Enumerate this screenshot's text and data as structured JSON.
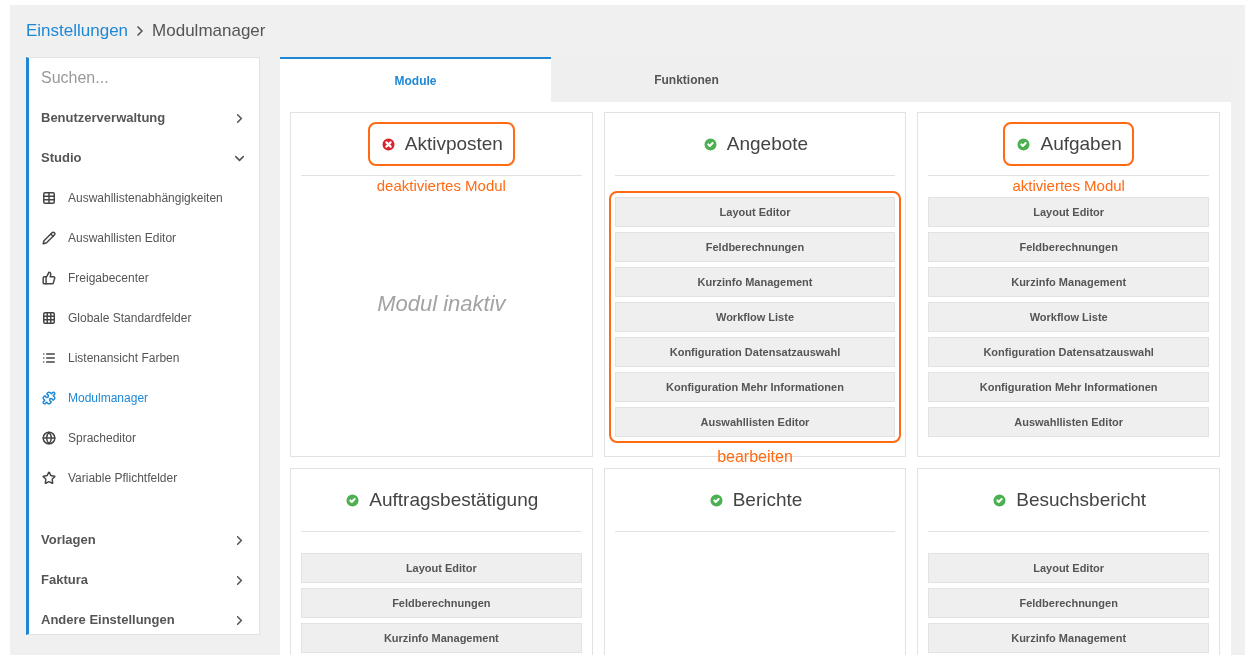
{
  "breadcrumb": {
    "parent": "Einstellungen",
    "current": "Modulmanager"
  },
  "sidebar": {
    "search_placeholder": "Suchen...",
    "sections": [
      {
        "label": "Benutzerverwaltung",
        "expanded": false
      },
      {
        "label": "Studio",
        "expanded": true,
        "children": [
          {
            "label": "Auswahllistenabhängigkeiten",
            "selected": false
          },
          {
            "label": "Auswahllisten Editor",
            "selected": false
          },
          {
            "label": "Freigabecenter",
            "selected": false
          },
          {
            "label": "Globale Standardfelder",
            "selected": false
          },
          {
            "label": "Listenansicht Farben",
            "selected": false
          },
          {
            "label": "Modulmanager",
            "selected": true
          },
          {
            "label": "Spracheditor",
            "selected": false
          },
          {
            "label": "Variable Pflichtfelder",
            "selected": false
          }
        ]
      },
      {
        "label": "Vorlagen",
        "expanded": false
      },
      {
        "label": "Faktura",
        "expanded": false
      },
      {
        "label": "Andere Einstellungen",
        "expanded": false
      }
    ]
  },
  "tabs": [
    {
      "label": "Module",
      "selected": true
    },
    {
      "label": "Funktionen",
      "selected": false
    }
  ],
  "modules": [
    {
      "name": "Aktivposten",
      "active": false,
      "title_highlighted": true,
      "annotation": "deaktiviertes Modul",
      "inactive_text": "Modul inaktiv"
    },
    {
      "name": "Angebote",
      "active": true,
      "buttons_highlighted": true,
      "buttons_annotation": "bearbeiten",
      "buttons": [
        "Layout Editor",
        "Feldberechnungen",
        "Kurzinfo Management",
        "Workflow Liste",
        "Konfiguration Datensatzauswahl",
        "Konfiguration Mehr Informationen",
        "Auswahllisten Editor"
      ]
    },
    {
      "name": "Aufgaben",
      "active": true,
      "title_highlighted": true,
      "annotation": "aktiviertes Modul",
      "buttons": [
        "Layout Editor",
        "Feldberechnungen",
        "Kurzinfo Management",
        "Workflow Liste",
        "Konfiguration Datensatzauswahl",
        "Konfiguration Mehr Informationen",
        "Auswahllisten Editor"
      ]
    },
    {
      "name": "Auftragsbestätigung",
      "active": true,
      "buttons": [
        "Layout Editor",
        "Feldberechnungen",
        "Kurzinfo Management"
      ]
    },
    {
      "name": "Berichte",
      "active": true
    },
    {
      "name": "Besuchsbericht",
      "active": true,
      "buttons": [
        "Layout Editor",
        "Feldberechnungen",
        "Kurzinfo Management"
      ]
    }
  ]
}
